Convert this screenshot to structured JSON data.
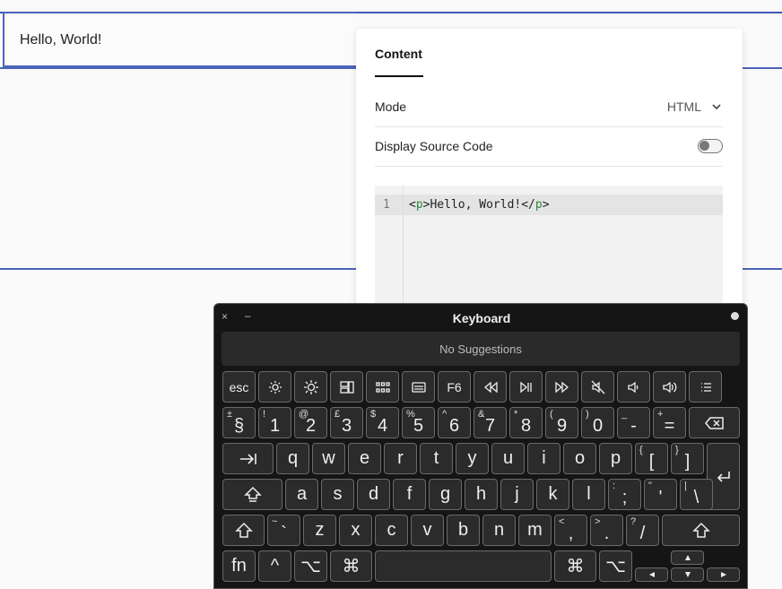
{
  "canvas": {
    "hello_text": "Hello, World!"
  },
  "panel": {
    "tab_label": "Content",
    "mode_label": "Mode",
    "mode_value": "HTML",
    "display_source_label": "Display Source Code",
    "display_source_on": false,
    "code": {
      "line_number": "1",
      "lt": "<",
      "tag_open": "p",
      "gt1": ">",
      "content": "Hello, World!",
      "close_lt": "</",
      "tag_close": "p",
      "gt2": ">"
    }
  },
  "keyboard": {
    "title": "Keyboard",
    "close": "×",
    "minimize": "–",
    "suggestions": "No Suggestions",
    "row_fn": [
      "esc",
      "F6"
    ],
    "row_num": [
      {
        "s": "±",
        "m": "§"
      },
      {
        "s": "!",
        "m": "1"
      },
      {
        "s": "@",
        "m": "2"
      },
      {
        "s": "£",
        "m": "3"
      },
      {
        "s": "$",
        "m": "4"
      },
      {
        "s": "%",
        "m": "5"
      },
      {
        "s": "^",
        "m": "6"
      },
      {
        "s": "&",
        "m": "7"
      },
      {
        "s": "*",
        "m": "8"
      },
      {
        "s": "(",
        "m": "9"
      },
      {
        "s": ")",
        "m": "0"
      },
      {
        "s": "_",
        "m": "-"
      },
      {
        "s": "+",
        "m": "="
      }
    ],
    "row_q": [
      "q",
      "w",
      "e",
      "r",
      "t",
      "y",
      "u",
      "i",
      "o",
      "p"
    ],
    "row_q_extra": [
      {
        "s": "{",
        "m": "["
      },
      {
        "s": "}",
        "m": "]"
      }
    ],
    "row_a": [
      "a",
      "s",
      "d",
      "f",
      "g",
      "h",
      "j",
      "k",
      "l"
    ],
    "row_a_extra": [
      {
        "s": ":",
        "m": ";"
      },
      {
        "s": "\"",
        "m": "'"
      },
      {
        "s": "|",
        "m": "\\"
      }
    ],
    "row_z": [
      "z",
      "x",
      "c",
      "v",
      "b",
      "n",
      "m"
    ],
    "row_z_tilde": {
      "s": "~",
      "m": "`"
    },
    "row_z_extra": [
      {
        "s": "<",
        "m": ","
      },
      {
        "s": ">",
        "m": "."
      },
      {
        "s": "?",
        "m": "/"
      }
    ],
    "fn_label": "fn",
    "ctrl_label": "^",
    "opt_label": "⌥",
    "cmd_label": "⌘"
  }
}
